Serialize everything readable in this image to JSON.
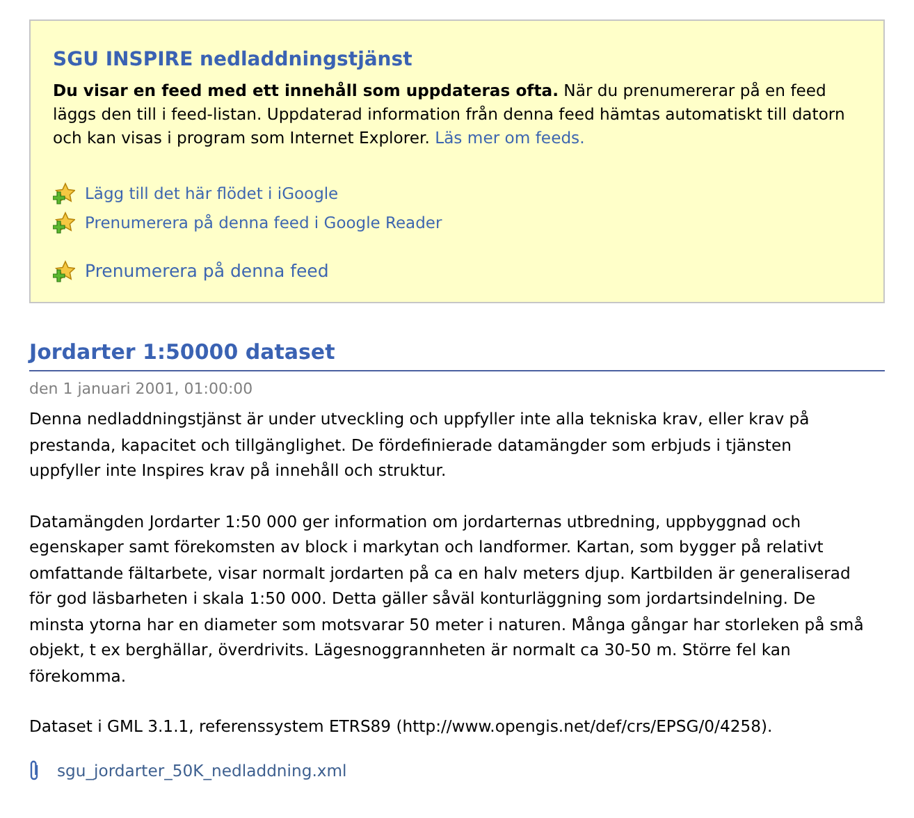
{
  "feed_notice": {
    "title": "SGU INSPIRE nedladdningstjänst",
    "text": "**Du visar en feed med ett innehåll som uppdateras ofta.** När du prenumererar på en feed läggs den till i feed-listan. Uppdaterad information från denna feed hämtas automatiskt till datorn och kan visas i program som Internet Explorer.",
    "more_link": "Läs mer om feeds.",
    "links": [
      {
        "label": "Lägg till det här flödet i iGoogle",
        "kind": "service"
      },
      {
        "label": "Prenumerera på denna feed i Google Reader",
        "kind": "service"
      },
      {
        "label": "Prenumerera på denna feed",
        "kind": "direct"
      }
    ]
  },
  "entry": {
    "title": "Jordarter 1:50000 dataset",
    "date": "den 1 januari 2001, 01:00:00",
    "paragraphs": [
      "Denna nedladdningstjänst är under utveckling och uppfyller inte alla tekniska krav, eller krav på prestanda, kapacitet och tillgänglighet. De fördefinierade datamängder som erbjuds i tjänsten uppfyller inte Inspires krav på innehåll och struktur.",
      "Datamängden Jordarter 1:50 000 ger information om jordarternas utbredning, uppbyggnad och egenskaper samt förekomsten av block i markytan och landformer. Kartan, som bygger på relativt omfattande fältarbete, visar normalt jordarten på ca en halv meters djup. Kartbilden är generaliserad för god läsbarheten i skala 1:50 000. Detta gäller såväl konturläggning som jordartsindelning. De minsta ytorna har en diameter som motsvarar 50 meter i naturen. Många gångar har storleken på små objekt, t ex berghällar, överdrivits. Lägesnoggrannheten är normalt ca 30-50 m. Större fel kan förekomma.",
      "Dataset i GML 3.1.1, referenssystem ETRS89 (http://www.opengis.net/def/crs/EPSG/0/4258)."
    ],
    "attachment": "sgu_jordarter_50K_nedladdning.xml"
  }
}
